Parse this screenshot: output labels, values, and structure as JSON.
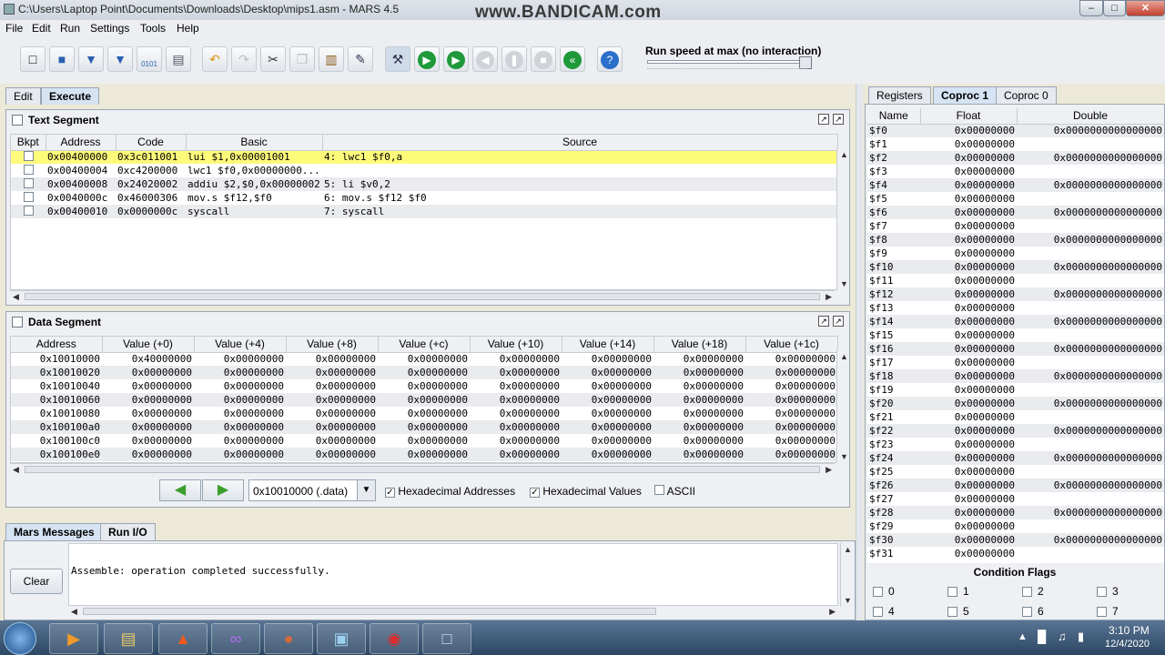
{
  "window": {
    "title": "C:\\Users\\Laptop Point\\Documents\\Downloads\\Desktop\\mips1.asm  - MARS 4.5",
    "watermark": "www.BANDICAM.com",
    "minimize": "–",
    "maximize": "□",
    "close": "✕"
  },
  "menu": [
    "File",
    "Edit",
    "Run",
    "Settings",
    "Tools",
    "Help"
  ],
  "toolbar": {
    "icons": [
      "new-icon",
      "open-icon",
      "save-icon",
      "save-as-icon",
      "dump-memory-icon",
      "print-icon",
      "undo-icon",
      "redo-icon",
      "cut-icon",
      "copy-icon",
      "paste-icon",
      "find-replace-icon",
      "assemble-icon",
      "run-icon",
      "step-icon",
      "backstep-icon",
      "pause-icon",
      "stop-icon",
      "reset-icon",
      "help-icon"
    ],
    "dump_label": "0101",
    "speed_label": "Run speed at max (no interaction)",
    "speed_value": 1.0
  },
  "tabs": {
    "edit": "Edit",
    "execute": "Execute"
  },
  "text_segment": {
    "title": "Text Segment",
    "columns": [
      "Bkpt",
      "Address",
      "Code",
      "Basic",
      "Source"
    ],
    "rows": [
      {
        "address": "0x00400000",
        "code": "0x3c011001",
        "basic": "lui $1,0x00001001",
        "source": "4: lwc1 $f0,a"
      },
      {
        "address": "0x00400004",
        "code": "0xc4200000",
        "basic": "lwc1 $f0,0x00000000...",
        "source": ""
      },
      {
        "address": "0x00400008",
        "code": "0x24020002",
        "basic": "addiu $2,$0,0x00000002",
        "source": "5: li $v0,2"
      },
      {
        "address": "0x0040000c",
        "code": "0x46000306",
        "basic": "mov.s $f12,$f0",
        "source": "6: mov.s $f12 $f0"
      },
      {
        "address": "0x00400010",
        "code": "0x0000000c",
        "basic": "syscall",
        "source": "7: syscall"
      }
    ]
  },
  "data_segment": {
    "title": "Data Segment",
    "columns": [
      "Address",
      "Value (+0)",
      "Value (+4)",
      "Value (+8)",
      "Value (+c)",
      "Value (+10)",
      "Value (+14)",
      "Value (+18)",
      "Value (+1c)"
    ],
    "rows": [
      [
        "0x10010000",
        "0x40000000",
        "0x00000000",
        "0x00000000",
        "0x00000000",
        "0x00000000",
        "0x00000000",
        "0x00000000",
        "0x00000000"
      ],
      [
        "0x10010020",
        "0x00000000",
        "0x00000000",
        "0x00000000",
        "0x00000000",
        "0x00000000",
        "0x00000000",
        "0x00000000",
        "0x00000000"
      ],
      [
        "0x10010040",
        "0x00000000",
        "0x00000000",
        "0x00000000",
        "0x00000000",
        "0x00000000",
        "0x00000000",
        "0x00000000",
        "0x00000000"
      ],
      [
        "0x10010060",
        "0x00000000",
        "0x00000000",
        "0x00000000",
        "0x00000000",
        "0x00000000",
        "0x00000000",
        "0x00000000",
        "0x00000000"
      ],
      [
        "0x10010080",
        "0x00000000",
        "0x00000000",
        "0x00000000",
        "0x00000000",
        "0x00000000",
        "0x00000000",
        "0x00000000",
        "0x00000000"
      ],
      [
        "0x100100a0",
        "0x00000000",
        "0x00000000",
        "0x00000000",
        "0x00000000",
        "0x00000000",
        "0x00000000",
        "0x00000000",
        "0x00000000"
      ],
      [
        "0x100100c0",
        "0x00000000",
        "0x00000000",
        "0x00000000",
        "0x00000000",
        "0x00000000",
        "0x00000000",
        "0x00000000",
        "0x00000000"
      ],
      [
        "0x100100e0",
        "0x00000000",
        "0x00000000",
        "0x00000000",
        "0x00000000",
        "0x00000000",
        "0x00000000",
        "0x00000000",
        "0x00000000"
      ]
    ],
    "segment_select": "0x10010000 (.data)",
    "hex_addresses": "Hexadecimal Addresses",
    "hex_values": "Hexadecimal Values",
    "ascii": "ASCII",
    "hex_addresses_checked": true,
    "hex_values_checked": true,
    "ascii_checked": false
  },
  "messages": {
    "tab_mars": "Mars Messages",
    "tab_runio": "Run I/O",
    "clear": "Clear",
    "text": "Assemble: operation completed successfully."
  },
  "registers": {
    "tabs": [
      "Registers",
      "Coproc 1",
      "Coproc 0"
    ],
    "active_tab": "Coproc 1",
    "columns": [
      "Name",
      "Float",
      "Double"
    ],
    "rows": [
      [
        "$f0",
        "0x00000000",
        "0x0000000000000000"
      ],
      [
        "$f1",
        "0x00000000",
        ""
      ],
      [
        "$f2",
        "0x00000000",
        "0x0000000000000000"
      ],
      [
        "$f3",
        "0x00000000",
        ""
      ],
      [
        "$f4",
        "0x00000000",
        "0x0000000000000000"
      ],
      [
        "$f5",
        "0x00000000",
        ""
      ],
      [
        "$f6",
        "0x00000000",
        "0x0000000000000000"
      ],
      [
        "$f7",
        "0x00000000",
        ""
      ],
      [
        "$f8",
        "0x00000000",
        "0x0000000000000000"
      ],
      [
        "$f9",
        "0x00000000",
        ""
      ],
      [
        "$f10",
        "0x00000000",
        "0x0000000000000000"
      ],
      [
        "$f11",
        "0x00000000",
        ""
      ],
      [
        "$f12",
        "0x00000000",
        "0x0000000000000000"
      ],
      [
        "$f13",
        "0x00000000",
        ""
      ],
      [
        "$f14",
        "0x00000000",
        "0x0000000000000000"
      ],
      [
        "$f15",
        "0x00000000",
        ""
      ],
      [
        "$f16",
        "0x00000000",
        "0x0000000000000000"
      ],
      [
        "$f17",
        "0x00000000",
        ""
      ],
      [
        "$f18",
        "0x00000000",
        "0x0000000000000000"
      ],
      [
        "$f19",
        "0x00000000",
        ""
      ],
      [
        "$f20",
        "0x00000000",
        "0x0000000000000000"
      ],
      [
        "$f21",
        "0x00000000",
        ""
      ],
      [
        "$f22",
        "0x00000000",
        "0x0000000000000000"
      ],
      [
        "$f23",
        "0x00000000",
        ""
      ],
      [
        "$f24",
        "0x00000000",
        "0x0000000000000000"
      ],
      [
        "$f25",
        "0x00000000",
        ""
      ],
      [
        "$f26",
        "0x00000000",
        "0x0000000000000000"
      ],
      [
        "$f27",
        "0x00000000",
        ""
      ],
      [
        "$f28",
        "0x00000000",
        "0x0000000000000000"
      ],
      [
        "$f29",
        "0x00000000",
        ""
      ],
      [
        "$f30",
        "0x00000000",
        "0x0000000000000000"
      ],
      [
        "$f31",
        "0x00000000",
        ""
      ]
    ],
    "condition_flags_title": "Condition Flags",
    "flags": [
      "0",
      "1",
      "2",
      "3",
      "4",
      "5",
      "6",
      "7"
    ]
  },
  "taskbar": {
    "apps": [
      "windows-start-icon",
      "media-player-icon",
      "file-explorer-icon",
      "brave-browser-icon",
      "visual-studio-icon",
      "photo-app-icon",
      "network-app-icon",
      "bandicam-icon",
      "java-app-icon"
    ],
    "time": "3:10 PM",
    "date": "12/4/2020"
  },
  "colors": {
    "highlight_row": "#fffb7a",
    "active_tab": "#d5e3f3",
    "taskbar": "#2c4763"
  }
}
